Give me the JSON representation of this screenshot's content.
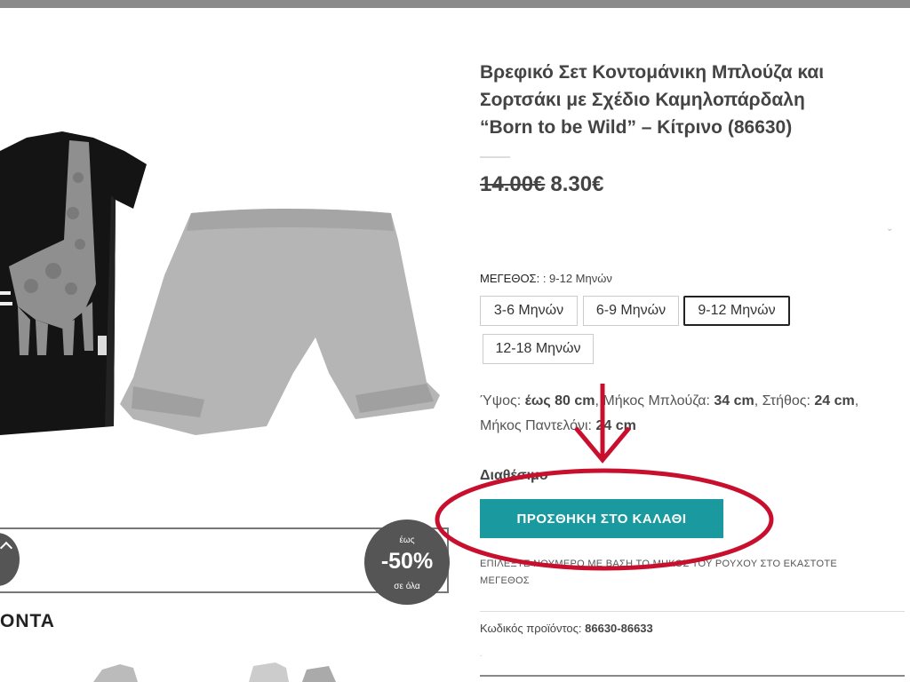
{
  "product": {
    "title_line1": "Βρεφικό Σετ Κοντομάνικη Μπλούζα και",
    "title_line2": "Σορτσάκι με Σχέδιο Καμηλοπάρδαλη",
    "title_line3": "“Born to be Wild” – Κίτρινο (86630)",
    "price_old": "14.00€",
    "price_new": "8.30€",
    "size_label": "ΜΕΓΕΘΟΣ:",
    "size_selected_value": ": 9-12 Μηνών",
    "sizes": [
      {
        "label": "3-6 Μηνών",
        "selected": false
      },
      {
        "label": "6-9 Μηνών",
        "selected": false
      },
      {
        "label": "9-12 Μηνών",
        "selected": true
      },
      {
        "label": "12-18 Μηνών",
        "selected": false
      }
    ],
    "measurements": {
      "height_label": "Ύψος:",
      "height_value": "έως 80 cm",
      "shirt_length_label": ", Μήκος Μπλούζα:",
      "shirt_length_value": "34 cm",
      "chest_label": ", Στήθος:",
      "chest_value": "24 cm",
      "pants_length_label": ", Μήκος Παντελόνι:",
      "pants_length_value": "24 cm"
    },
    "availability": "Διαθέσιμο",
    "add_to_cart_label": "ΠΡΟΣΘΗΚΗ ΣΤΟ ΚΑΛΑΘΙ",
    "note": "ΕΠΙΛΕΞΤΕ ΝΟΥΜΕΡΟ ΜΕ ΒΑΣΗ ΤΟ ΜΗΚΟΣ ΤΟΥ ΡΟΥΧΟΥ ΣΤΟ ΕΚΑΣΤΟΤΕ ΜΕΓΕΘΟΣ",
    "sku_label": "Κωδικός προϊόντος:",
    "sku_value": "86630-86633"
  },
  "promo": {
    "discount_top": "έως",
    "discount_main": "-50%",
    "discount_bottom": "σε όλα"
  },
  "related_heading": "ΟΝΤΑ",
  "icons": {
    "prev": "chevron-left-icon",
    "small_chevron": "chevron-down-icon"
  },
  "colors": {
    "cart_button": "#1a9a9e",
    "annotation": "#c8102e"
  }
}
